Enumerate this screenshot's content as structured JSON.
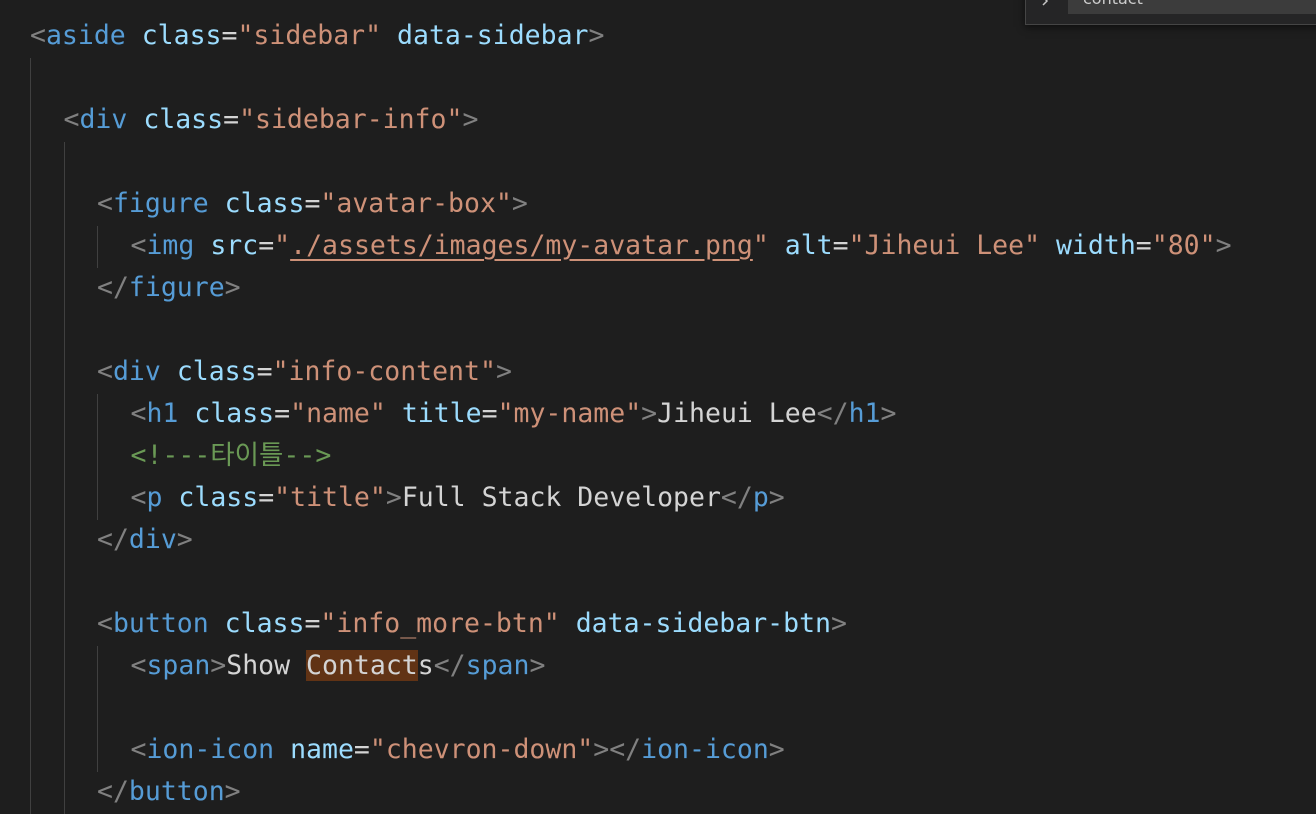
{
  "find_widget": {
    "query": "contact",
    "toggle_icon": "chevron-right-icon"
  },
  "highlight_color": "#613315",
  "lines": [
    {
      "indent": 0,
      "tokens": [
        {
          "t": "<",
          "c": "punct"
        },
        {
          "t": "aside",
          "c": "tag"
        },
        {
          "t": " ",
          "c": "text"
        },
        {
          "t": "class",
          "c": "attr"
        },
        {
          "t": "=",
          "c": "eq"
        },
        {
          "t": "\"sidebar\"",
          "c": "str"
        },
        {
          "t": " ",
          "c": "text"
        },
        {
          "t": "data-sidebar",
          "c": "attr"
        },
        {
          "t": ">",
          "c": "punct"
        }
      ]
    },
    {
      "indent": 0,
      "tokens": []
    },
    {
      "indent": 1,
      "tokens": [
        {
          "t": "<",
          "c": "punct"
        },
        {
          "t": "div",
          "c": "tag"
        },
        {
          "t": " ",
          "c": "text"
        },
        {
          "t": "class",
          "c": "attr"
        },
        {
          "t": "=",
          "c": "eq"
        },
        {
          "t": "\"sidebar-info\"",
          "c": "str"
        },
        {
          "t": ">",
          "c": "punct"
        }
      ]
    },
    {
      "indent": 0,
      "tokens": []
    },
    {
      "indent": 2,
      "tokens": [
        {
          "t": "<",
          "c": "punct"
        },
        {
          "t": "figure",
          "c": "tag"
        },
        {
          "t": " ",
          "c": "text"
        },
        {
          "t": "class",
          "c": "attr"
        },
        {
          "t": "=",
          "c": "eq"
        },
        {
          "t": "\"avatar-box\"",
          "c": "str"
        },
        {
          "t": ">",
          "c": "punct"
        }
      ]
    },
    {
      "indent": 3,
      "tokens": [
        {
          "t": "<",
          "c": "punct"
        },
        {
          "t": "img",
          "c": "tag"
        },
        {
          "t": " ",
          "c": "text"
        },
        {
          "t": "src",
          "c": "attr"
        },
        {
          "t": "=",
          "c": "eq"
        },
        {
          "t": "\"",
          "c": "str"
        },
        {
          "t": "./assets/images/my-avatar.png",
          "c": "str link"
        },
        {
          "t": "\"",
          "c": "str"
        },
        {
          "t": " ",
          "c": "text"
        },
        {
          "t": "alt",
          "c": "attr"
        },
        {
          "t": "=",
          "c": "eq"
        },
        {
          "t": "\"Jiheui Lee\"",
          "c": "str"
        },
        {
          "t": " ",
          "c": "text"
        },
        {
          "t": "width",
          "c": "attr"
        },
        {
          "t": "=",
          "c": "eq"
        },
        {
          "t": "\"80\"",
          "c": "str"
        },
        {
          "t": ">",
          "c": "punct"
        }
      ]
    },
    {
      "indent": 2,
      "tokens": [
        {
          "t": "</",
          "c": "punct"
        },
        {
          "t": "figure",
          "c": "tag"
        },
        {
          "t": ">",
          "c": "punct"
        }
      ]
    },
    {
      "indent": 0,
      "tokens": []
    },
    {
      "indent": 2,
      "tokens": [
        {
          "t": "<",
          "c": "punct"
        },
        {
          "t": "div",
          "c": "tag"
        },
        {
          "t": " ",
          "c": "text"
        },
        {
          "t": "class",
          "c": "attr"
        },
        {
          "t": "=",
          "c": "eq"
        },
        {
          "t": "\"info-content\"",
          "c": "str"
        },
        {
          "t": ">",
          "c": "punct"
        }
      ]
    },
    {
      "indent": 3,
      "tokens": [
        {
          "t": "<",
          "c": "punct"
        },
        {
          "t": "h1",
          "c": "tag"
        },
        {
          "t": " ",
          "c": "text"
        },
        {
          "t": "class",
          "c": "attr"
        },
        {
          "t": "=",
          "c": "eq"
        },
        {
          "t": "\"name\"",
          "c": "str"
        },
        {
          "t": " ",
          "c": "text"
        },
        {
          "t": "title",
          "c": "attr"
        },
        {
          "t": "=",
          "c": "eq"
        },
        {
          "t": "\"my-name\"",
          "c": "str"
        },
        {
          "t": ">",
          "c": "punct"
        },
        {
          "t": "Jiheui Lee",
          "c": "text"
        },
        {
          "t": "</",
          "c": "punct"
        },
        {
          "t": "h1",
          "c": "tag"
        },
        {
          "t": ">",
          "c": "punct"
        }
      ]
    },
    {
      "indent": 3,
      "tokens": [
        {
          "t": "<!---타이틀-->",
          "c": "comment"
        }
      ]
    },
    {
      "indent": 3,
      "tokens": [
        {
          "t": "<",
          "c": "punct"
        },
        {
          "t": "p",
          "c": "tag"
        },
        {
          "t": " ",
          "c": "text"
        },
        {
          "t": "class",
          "c": "attr"
        },
        {
          "t": "=",
          "c": "eq"
        },
        {
          "t": "\"title\"",
          "c": "str"
        },
        {
          "t": ">",
          "c": "punct"
        },
        {
          "t": "Full Stack Developer",
          "c": "text"
        },
        {
          "t": "</",
          "c": "punct"
        },
        {
          "t": "p",
          "c": "tag"
        },
        {
          "t": ">",
          "c": "punct"
        }
      ]
    },
    {
      "indent": 2,
      "tokens": [
        {
          "t": "</",
          "c": "punct"
        },
        {
          "t": "div",
          "c": "tag"
        },
        {
          "t": ">",
          "c": "punct"
        }
      ]
    },
    {
      "indent": 0,
      "tokens": []
    },
    {
      "indent": 2,
      "tokens": [
        {
          "t": "<",
          "c": "punct"
        },
        {
          "t": "button",
          "c": "tag"
        },
        {
          "t": " ",
          "c": "text"
        },
        {
          "t": "class",
          "c": "attr"
        },
        {
          "t": "=",
          "c": "eq"
        },
        {
          "t": "\"info_more-btn\"",
          "c": "str"
        },
        {
          "t": " ",
          "c": "text"
        },
        {
          "t": "data-sidebar-btn",
          "c": "attr"
        },
        {
          "t": ">",
          "c": "punct"
        }
      ]
    },
    {
      "indent": 3,
      "tokens": [
        {
          "t": "<",
          "c": "punct"
        },
        {
          "t": "span",
          "c": "tag"
        },
        {
          "t": ">",
          "c": "punct"
        },
        {
          "t": "Show ",
          "c": "text"
        },
        {
          "t": "Contact",
          "c": "text hl"
        },
        {
          "t": "s",
          "c": "text"
        },
        {
          "t": "</",
          "c": "punct"
        },
        {
          "t": "span",
          "c": "tag"
        },
        {
          "t": ">",
          "c": "punct"
        }
      ]
    },
    {
      "indent": 0,
      "tokens": []
    },
    {
      "indent": 3,
      "tokens": [
        {
          "t": "<",
          "c": "punct"
        },
        {
          "t": "ion-icon",
          "c": "tag"
        },
        {
          "t": " ",
          "c": "text"
        },
        {
          "t": "name",
          "c": "attr"
        },
        {
          "t": "=",
          "c": "eq"
        },
        {
          "t": "\"chevron-down\"",
          "c": "str"
        },
        {
          "t": ">",
          "c": "punct"
        },
        {
          "t": "</",
          "c": "punct"
        },
        {
          "t": "ion-icon",
          "c": "tag"
        },
        {
          "t": ">",
          "c": "punct"
        }
      ]
    },
    {
      "indent": 2,
      "tokens": [
        {
          "t": "</",
          "c": "punct"
        },
        {
          "t": "button",
          "c": "tag"
        },
        {
          "t": ">",
          "c": "punct"
        }
      ]
    }
  ]
}
